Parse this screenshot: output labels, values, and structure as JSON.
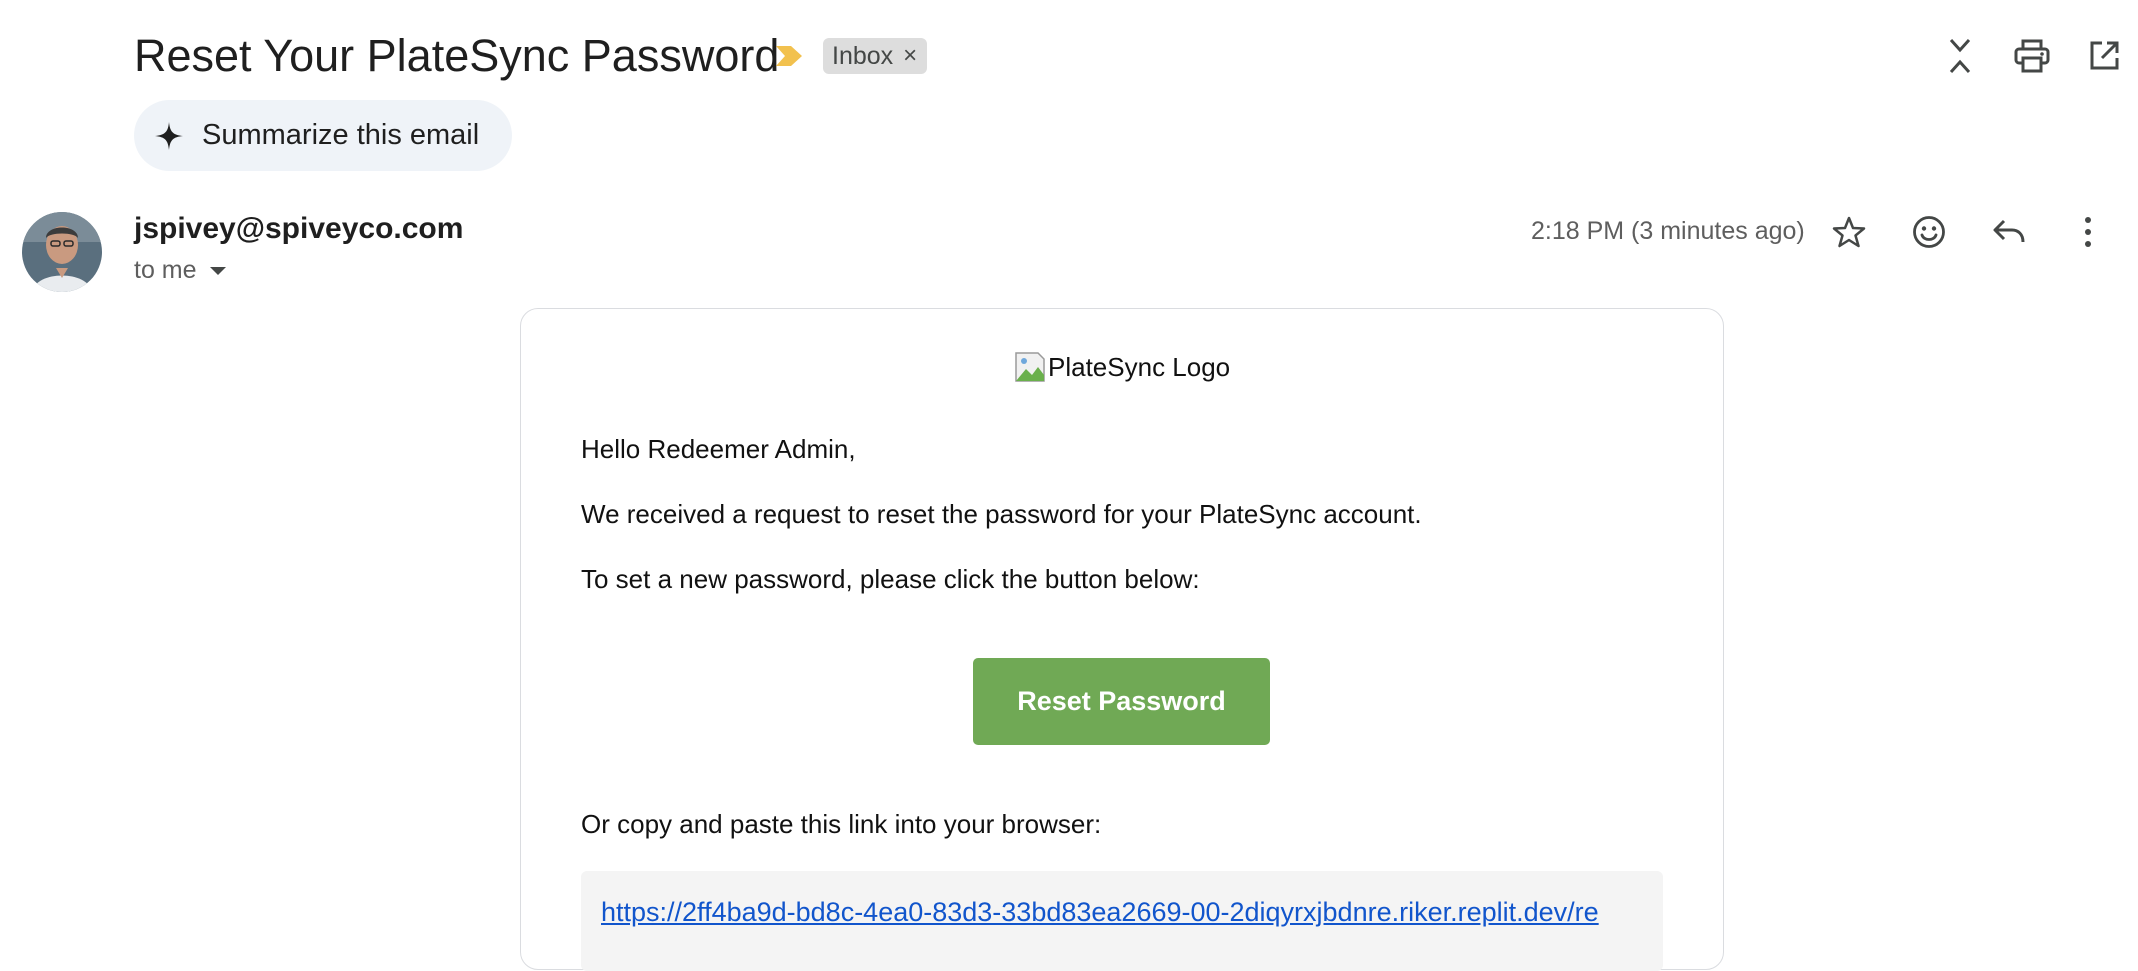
{
  "email": {
    "subject": "Reset Your PlateSync Password",
    "label": "Inbox",
    "label_remove": "×",
    "summarize_label": "Summarize this email",
    "sender": "jspivey@spiveyco.com",
    "recipient_label": "to me",
    "timestamp": "2:18 PM (3 minutes ago)"
  },
  "body": {
    "logo_alt": "PlateSync Logo",
    "greeting": "Hello Redeemer Admin,",
    "line1": "We received a request to reset the password for your PlateSync account.",
    "line2": "To set a new password, please click the button below:",
    "button_label": "Reset Password",
    "line3": "Or copy and paste this link into your browser:",
    "reset_link": "https://2ff4ba9d-bd8c-4ea0-83d3-33bd83ea2669-00-2diqyrxjbdnre.riker.replit.dev/re"
  },
  "colors": {
    "button_green": "#70a955",
    "importance_marker": "#f2c14e",
    "link_blue": "#1155cc",
    "chip_bg": "#dddddd",
    "summarize_bg": "#eff3f8"
  },
  "icons": {
    "importance": "importance-marker-icon",
    "collapse": "collapse-all-icon",
    "print": "print-icon",
    "open_new_window": "open-in-new-window-icon",
    "sparkle": "sparkle-icon",
    "star": "star-icon",
    "emoji": "emoji-reaction-icon",
    "reply": "reply-icon",
    "more": "more-vert-icon",
    "dropdown": "caret-down-icon",
    "broken_image": "broken-image-icon"
  }
}
